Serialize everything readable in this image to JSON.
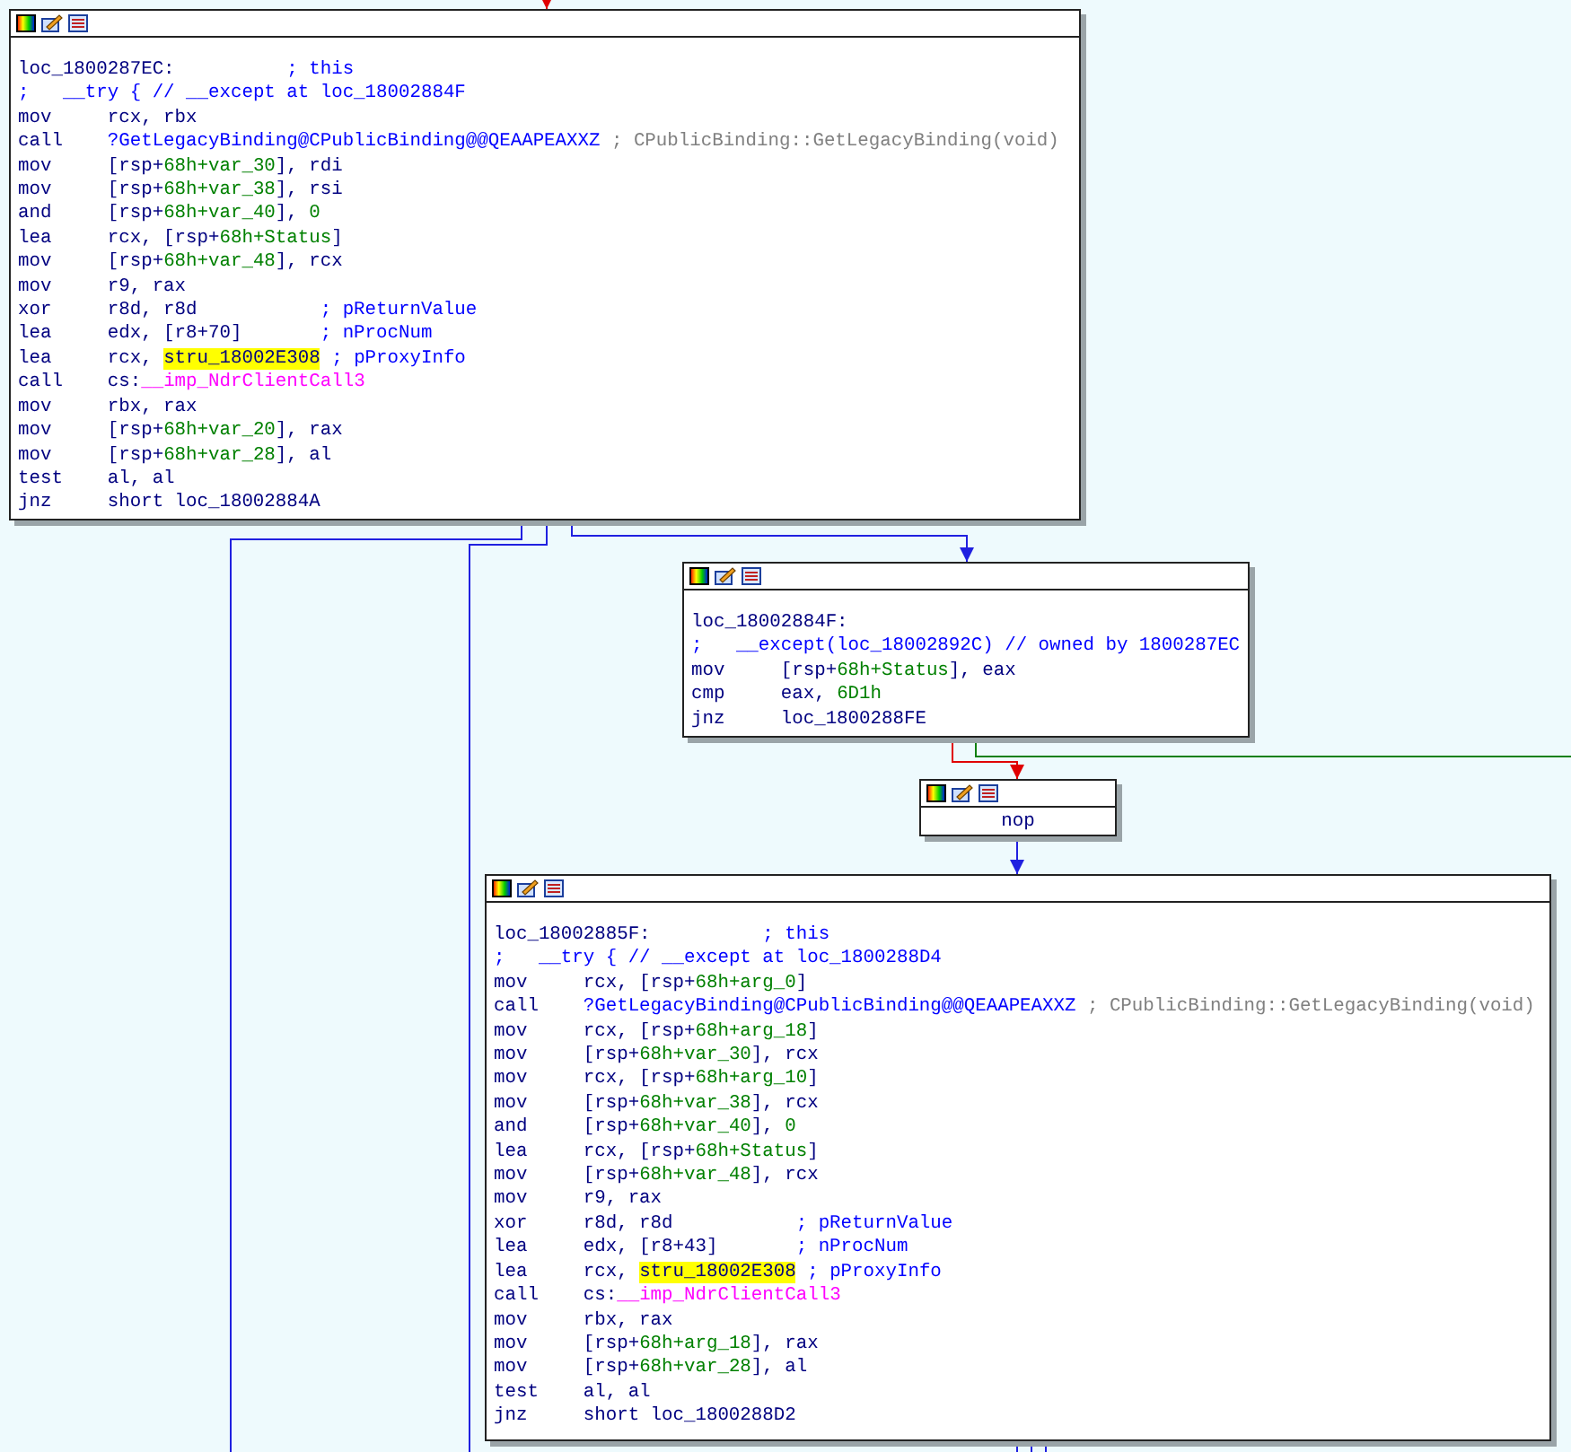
{
  "blocks": [
    {
      "kind": "code",
      "lines": [
        {
          "kind": "label",
          "label": "loc_1800287EC:",
          "comment": [
            {
              "text": "; this",
              "kind": "comment"
            }
          ]
        },
        {
          "kind": "note",
          "comment": [
            {
              "text": ";   __try { // __except at loc_18002884F",
              "kind": "comment"
            }
          ]
        },
        {
          "kind": "insn",
          "mnemonic": "mov",
          "operands": [
            {
              "text": "rcx, rbx"
            }
          ]
        },
        {
          "kind": "insn",
          "mnemonic": "call",
          "operands": [
            {
              "text": "?GetLegacyBinding@CPublicBinding@@QEAAPEAXXZ",
              "kind": "name"
            }
          ],
          "comment": [
            {
              "text": "; CPublicBinding::GetLegacyBinding(void)",
              "kind": "demangled"
            }
          ]
        },
        {
          "kind": "insn",
          "mnemonic": "mov",
          "operands": [
            {
              "text": "[rsp+"
            },
            {
              "text": "68h+var_30",
              "kind": "var"
            },
            {
              "text": "], rdi"
            }
          ]
        },
        {
          "kind": "insn",
          "mnemonic": "mov",
          "operands": [
            {
              "text": "[rsp+"
            },
            {
              "text": "68h+var_38",
              "kind": "var"
            },
            {
              "text": "], rsi"
            }
          ]
        },
        {
          "kind": "insn",
          "mnemonic": "and",
          "operands": [
            {
              "text": "[rsp+"
            },
            {
              "text": "68h+var_40",
              "kind": "var"
            },
            {
              "text": "], "
            },
            {
              "text": "0",
              "kind": "var"
            }
          ]
        },
        {
          "kind": "insn",
          "mnemonic": "lea",
          "operands": [
            {
              "text": "rcx, [rsp+"
            },
            {
              "text": "68h+Status",
              "kind": "var"
            },
            {
              "text": "]"
            }
          ]
        },
        {
          "kind": "insn",
          "mnemonic": "mov",
          "operands": [
            {
              "text": "[rsp+"
            },
            {
              "text": "68h+var_48",
              "kind": "var"
            },
            {
              "text": "], rcx"
            }
          ]
        },
        {
          "kind": "insn",
          "mnemonic": "mov",
          "operands": [
            {
              "text": "r9, rax"
            }
          ]
        },
        {
          "kind": "insn",
          "mnemonic": "xor",
          "operands": [
            {
              "text": "r8d, r8d"
            }
          ],
          "comment": [
            {
              "text": "; pReturnValue",
              "kind": "comment"
            }
          ]
        },
        {
          "kind": "insn",
          "mnemonic": "lea",
          "operands": [
            {
              "text": "edx, [r8+70]"
            }
          ],
          "comment": [
            {
              "text": "; nProcNum",
              "kind": "comment"
            }
          ]
        },
        {
          "kind": "insn",
          "mnemonic": "lea",
          "operands": [
            {
              "text": "rcx, "
            },
            {
              "text": "stru_18002E308",
              "kind": "highlight"
            }
          ],
          "comment": [
            {
              "text": "; pProxyInfo",
              "kind": "comment"
            }
          ]
        },
        {
          "kind": "insn",
          "mnemonic": "call",
          "operands": [
            {
              "text": "cs:"
            },
            {
              "text": "__imp_NdrClientCall3",
              "kind": "import"
            }
          ]
        },
        {
          "kind": "insn",
          "mnemonic": "mov",
          "operands": [
            {
              "text": "rbx, rax"
            }
          ]
        },
        {
          "kind": "insn",
          "mnemonic": "mov",
          "operands": [
            {
              "text": "[rsp+"
            },
            {
              "text": "68h+var_20",
              "kind": "var"
            },
            {
              "text": "], rax"
            }
          ]
        },
        {
          "kind": "insn",
          "mnemonic": "mov",
          "operands": [
            {
              "text": "[rsp+"
            },
            {
              "text": "68h+var_28",
              "kind": "var"
            },
            {
              "text": "], al"
            }
          ]
        },
        {
          "kind": "insn",
          "mnemonic": "test",
          "operands": [
            {
              "text": "al, al"
            }
          ]
        },
        {
          "kind": "insn",
          "mnemonic": "jnz",
          "operands": [
            {
              "text": "short loc_18002884A"
            }
          ]
        }
      ]
    },
    {
      "kind": "code",
      "lines": [
        {
          "kind": "label",
          "label": "loc_18002884F:"
        },
        {
          "kind": "note",
          "comment": [
            {
              "text": ";   __except(loc_18002892C) // owned by 1800287EC",
              "kind": "comment"
            }
          ]
        },
        {
          "kind": "insn",
          "mnemonic": "mov",
          "operands": [
            {
              "text": "[rsp+"
            },
            {
              "text": "68h+Status",
              "kind": "var"
            },
            {
              "text": "], eax"
            }
          ]
        },
        {
          "kind": "insn",
          "mnemonic": "cmp",
          "operands": [
            {
              "text": "eax, "
            },
            {
              "text": "6D1h",
              "kind": "var"
            }
          ]
        },
        {
          "kind": "insn",
          "mnemonic": "jnz",
          "operands": [
            {
              "text": "loc_1800288FE"
            }
          ]
        }
      ]
    },
    {
      "kind": "centered",
      "lines": [
        {
          "kind": "insn",
          "mnemonic": "nop"
        }
      ]
    },
    {
      "kind": "code",
      "lines": [
        {
          "kind": "label",
          "label": "loc_18002885F:",
          "comment": [
            {
              "text": "; this",
              "kind": "comment"
            }
          ]
        },
        {
          "kind": "note",
          "comment": [
            {
              "text": ";   __try { // __except at loc_1800288D4",
              "kind": "comment"
            }
          ]
        },
        {
          "kind": "insn",
          "mnemonic": "mov",
          "operands": [
            {
              "text": "rcx, [rsp+"
            },
            {
              "text": "68h+arg_0",
              "kind": "var"
            },
            {
              "text": "]"
            }
          ]
        },
        {
          "kind": "insn",
          "mnemonic": "call",
          "operands": [
            {
              "text": "?GetLegacyBinding@CPublicBinding@@QEAAPEAXXZ",
              "kind": "name"
            }
          ],
          "comment": [
            {
              "text": "; CPublicBinding::GetLegacyBinding(void)",
              "kind": "demangled"
            }
          ]
        },
        {
          "kind": "insn",
          "mnemonic": "mov",
          "operands": [
            {
              "text": "rcx, [rsp+"
            },
            {
              "text": "68h+arg_18",
              "kind": "var"
            },
            {
              "text": "]"
            }
          ]
        },
        {
          "kind": "insn",
          "mnemonic": "mov",
          "operands": [
            {
              "text": "[rsp+"
            },
            {
              "text": "68h+var_30",
              "kind": "var"
            },
            {
              "text": "], rcx"
            }
          ]
        },
        {
          "kind": "insn",
          "mnemonic": "mov",
          "operands": [
            {
              "text": "rcx, [rsp+"
            },
            {
              "text": "68h+arg_10",
              "kind": "var"
            },
            {
              "text": "]"
            }
          ]
        },
        {
          "kind": "insn",
          "mnemonic": "mov",
          "operands": [
            {
              "text": "[rsp+"
            },
            {
              "text": "68h+var_38",
              "kind": "var"
            },
            {
              "text": "], rcx"
            }
          ]
        },
        {
          "kind": "insn",
          "mnemonic": "and",
          "operands": [
            {
              "text": "[rsp+"
            },
            {
              "text": "68h+var_40",
              "kind": "var"
            },
            {
              "text": "], "
            },
            {
              "text": "0",
              "kind": "var"
            }
          ]
        },
        {
          "kind": "insn",
          "mnemonic": "lea",
          "operands": [
            {
              "text": "rcx, [rsp+"
            },
            {
              "text": "68h+Status",
              "kind": "var"
            },
            {
              "text": "]"
            }
          ]
        },
        {
          "kind": "insn",
          "mnemonic": "mov",
          "operands": [
            {
              "text": "[rsp+"
            },
            {
              "text": "68h+var_48",
              "kind": "var"
            },
            {
              "text": "], rcx"
            }
          ]
        },
        {
          "kind": "insn",
          "mnemonic": "mov",
          "operands": [
            {
              "text": "r9, rax"
            }
          ]
        },
        {
          "kind": "insn",
          "mnemonic": "xor",
          "operands": [
            {
              "text": "r8d, r8d"
            }
          ],
          "comment": [
            {
              "text": "; pReturnValue",
              "kind": "comment"
            }
          ]
        },
        {
          "kind": "insn",
          "mnemonic": "lea",
          "operands": [
            {
              "text": "edx, [r8+43]"
            }
          ],
          "comment": [
            {
              "text": "; nProcNum",
              "kind": "comment"
            }
          ]
        },
        {
          "kind": "insn",
          "mnemonic": "lea",
          "operands": [
            {
              "text": "rcx, "
            },
            {
              "text": "stru_18002E308",
              "kind": "highlight"
            }
          ],
          "comment": [
            {
              "text": "; pProxyInfo",
              "kind": "comment"
            }
          ]
        },
        {
          "kind": "insn",
          "mnemonic": "call",
          "operands": [
            {
              "text": "cs:"
            },
            {
              "text": "__imp_NdrClientCall3",
              "kind": "import"
            }
          ]
        },
        {
          "kind": "insn",
          "mnemonic": "mov",
          "operands": [
            {
              "text": "rbx, rax"
            }
          ]
        },
        {
          "kind": "insn",
          "mnemonic": "mov",
          "operands": [
            {
              "text": "[rsp+"
            },
            {
              "text": "68h+arg_18",
              "kind": "var"
            },
            {
              "text": "], rax"
            }
          ]
        },
        {
          "kind": "insn",
          "mnemonic": "mov",
          "operands": [
            {
              "text": "[rsp+"
            },
            {
              "text": "68h+var_28",
              "kind": "var"
            },
            {
              "text": "], al"
            }
          ]
        },
        {
          "kind": "insn",
          "mnemonic": "test",
          "operands": [
            {
              "text": "al, al"
            }
          ]
        },
        {
          "kind": "insn",
          "mnemonic": "jnz",
          "operands": [
            {
              "text": "short loc_1800288D2"
            }
          ]
        }
      ]
    }
  ]
}
